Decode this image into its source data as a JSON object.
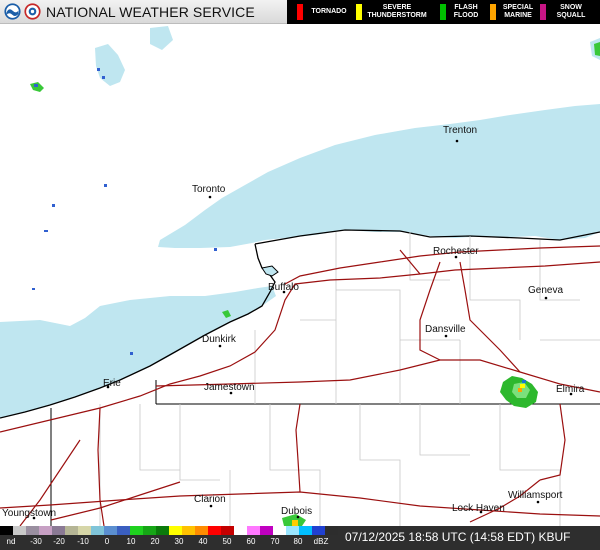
{
  "header": {
    "title": "NATIONAL WEATHER SERVICE",
    "warnings": [
      {
        "label": "TORNADO",
        "color": "#ff0000"
      },
      {
        "label": "SEVERE\nTHUNDERSTORM",
        "color": "#ffff00"
      },
      {
        "label": "FLASH\nFLOOD",
        "color": "#00c000"
      },
      {
        "label": "SPECIAL\nMARINE",
        "color": "#ffa500"
      },
      {
        "label": "SNOW\nSQUALL",
        "color": "#c71585"
      }
    ]
  },
  "map": {
    "lake_color": "#bfe6f0",
    "land_color": "#ffffff",
    "highway_color": "#9b1010",
    "border_color": "#000000",
    "county_color": "#c8c8c8",
    "cities": [
      "Trenton",
      "Toronto",
      "Rochester",
      "Geneva",
      "Buffalo",
      "Dansville",
      "Dunkirk",
      "Jamestown",
      "Elmira",
      "Erie",
      "Clarion",
      "Dubois",
      "Williamsport",
      "Lock Haven",
      "Youngstown"
    ]
  },
  "footer": {
    "dbz_labels": [
      "nd",
      "-30",
      "-20",
      "-10",
      "0",
      "10",
      "20",
      "30",
      "40",
      "50",
      "60",
      "70",
      "80",
      "dBZ"
    ],
    "timestamp": "07/12/2025 18:58 UTC (14:58 EDT)",
    "station": "KBUF"
  }
}
